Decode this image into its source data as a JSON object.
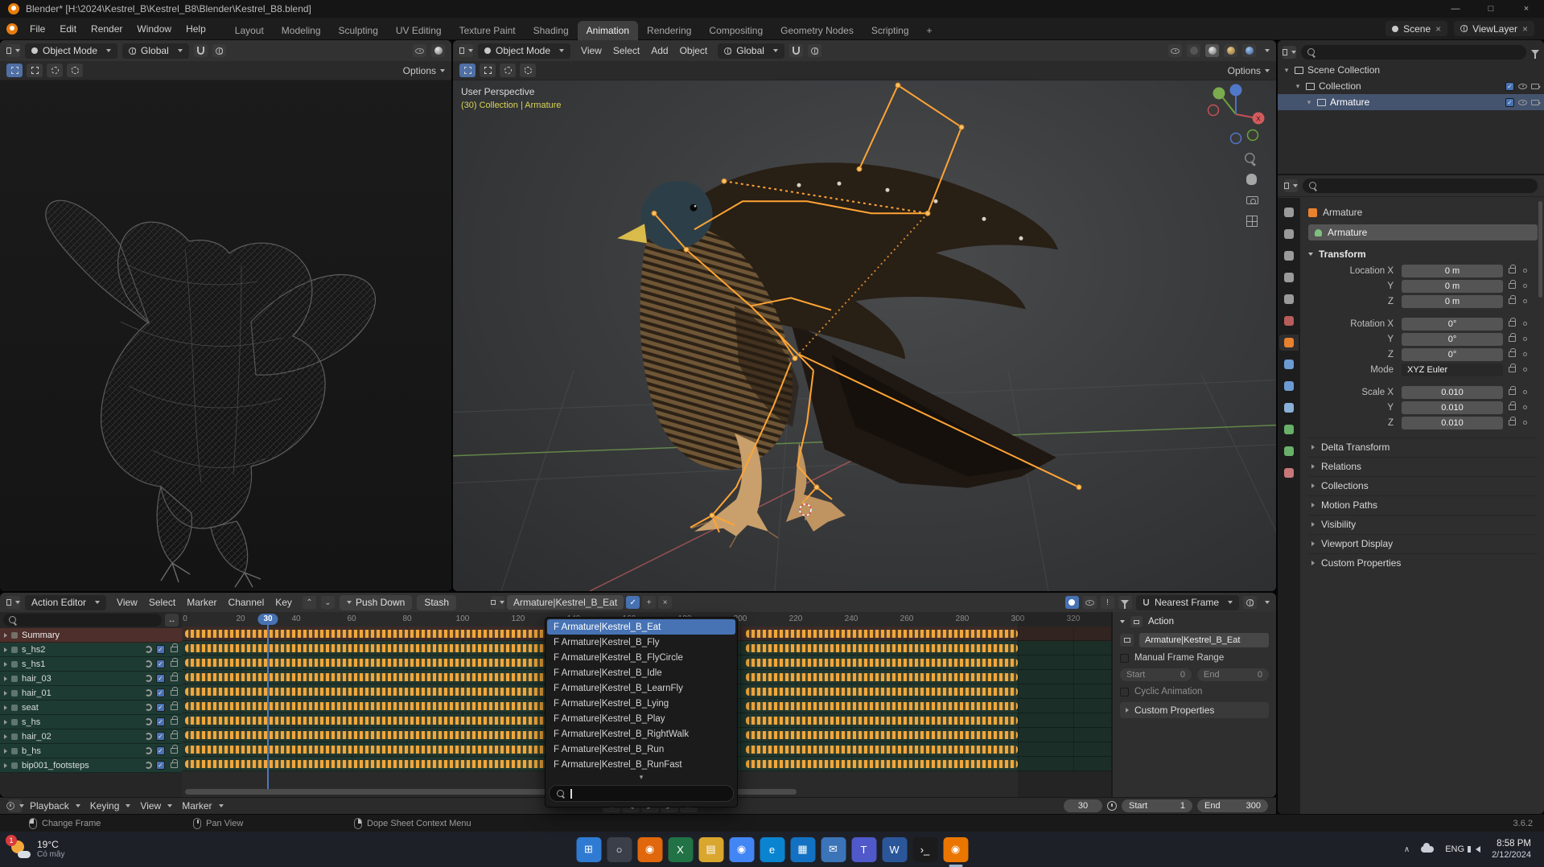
{
  "titlebar": {
    "title": "Blender* [H:\\2024\\Kestrel_B\\Kestrel_B8\\Blender\\Kestrel_B8.blend]",
    "minimize": "—",
    "maximize": "□",
    "close": "×"
  },
  "topbar": {
    "menus": [
      {
        "label": "File",
        "name": "menu-file"
      },
      {
        "label": "Edit",
        "name": "menu-edit"
      },
      {
        "label": "Render",
        "name": "menu-render"
      },
      {
        "label": "Window",
        "name": "menu-window"
      },
      {
        "label": "Help",
        "name": "menu-help"
      }
    ],
    "tabs": [
      {
        "label": "Layout",
        "name": "tab-layout"
      },
      {
        "label": "Modeling",
        "name": "tab-modeling"
      },
      {
        "label": "Sculpting",
        "name": "tab-sculpting"
      },
      {
        "label": "UV Editing",
        "name": "tab-uv-editing"
      },
      {
        "label": "Texture Paint",
        "name": "tab-texture-paint"
      },
      {
        "label": "Shading",
        "name": "tab-shading"
      },
      {
        "label": "Animation",
        "name": "tab-animation",
        "cls": "active"
      },
      {
        "label": "Rendering",
        "name": "tab-rendering"
      },
      {
        "label": "Compositing",
        "name": "tab-compositing"
      },
      {
        "label": "Geometry Nodes",
        "name": "tab-geometry-nodes"
      },
      {
        "label": "Scripting",
        "name": "tab-scripting"
      },
      {
        "label": "+",
        "name": "tab-add"
      }
    ],
    "scene": "Scene",
    "viewlayer": "ViewLayer"
  },
  "viewport_left": {
    "mode": "Object Mode",
    "orientation": "Global",
    "options": "Options"
  },
  "viewport_right": {
    "mode": "Object Mode",
    "menus": [
      {
        "label": "View",
        "name": "menu-view"
      },
      {
        "label": "Select",
        "name": "menu-select"
      },
      {
        "label": "Add",
        "name": "menu-add"
      },
      {
        "label": "Object",
        "name": "menu-object"
      }
    ],
    "orientation": "Global",
    "options": "Options",
    "overlay_line1": "User Perspective",
    "overlay_line2": "(30) Collection | Armature",
    "gizmo_x": "X"
  },
  "outliner": {
    "rows": [
      {
        "label": "Scene Collection",
        "depth": 0,
        "cls": "scene"
      },
      {
        "label": "Collection",
        "depth": 1,
        "cls": "collection"
      },
      {
        "label": "Armature",
        "depth": 2,
        "cls": "armature selected"
      }
    ]
  },
  "properties": {
    "breadcrumb": "Armature",
    "name": "Armature",
    "transform_title": "Transform",
    "rows": [
      {
        "label": "Location X",
        "value": "0 m"
      },
      {
        "label": "Y",
        "value": "0 m"
      },
      {
        "label": "Z",
        "value": "0 m"
      },
      {
        "label": "Rotation X",
        "value": "0°",
        "cls": "gap"
      },
      {
        "label": "Y",
        "value": "0°"
      },
      {
        "label": "Z",
        "value": "0°"
      },
      {
        "label": "Mode",
        "value": "XYZ Euler",
        "cls": "select"
      },
      {
        "label": "Scale X",
        "value": "0.010",
        "cls": "gap"
      },
      {
        "label": "Y",
        "value": "0.010"
      },
      {
        "label": "Z",
        "value": "0.010"
      }
    ],
    "sections": [
      "Delta Transform",
      "Relations",
      "Collections",
      "Motion Paths",
      "Visibility",
      "Viewport Display",
      "Custom Properties"
    ]
  },
  "properties_tabs": [
    {
      "name": "tab-tool",
      "color": "#9a9a9a"
    },
    {
      "name": "tab-render",
      "color": "#9a9a9a"
    },
    {
      "name": "tab-output",
      "color": "#9a9a9a"
    },
    {
      "name": "tab-view-layer",
      "color": "#9a9a9a"
    },
    {
      "name": "tab-scene",
      "color": "#9a9a9a"
    },
    {
      "name": "tab-world",
      "color": "#b85c5c"
    },
    {
      "name": "tab-object",
      "color": "#e8822e",
      "cls": "active"
    },
    {
      "name": "tab-modifiers",
      "color": "#6b9bd2"
    },
    {
      "name": "tab-physics",
      "color": "#6b9bd2"
    },
    {
      "name": "tab-constraints",
      "color": "#8ab0d8"
    },
    {
      "name": "tab-data",
      "color": "#69b06a"
    },
    {
      "name": "tab-bone",
      "color": "#69b06a"
    },
    {
      "name": "tab-material",
      "color": "#c77777"
    }
  ],
  "dopesheet": {
    "editor": "Action Editor",
    "menus": [
      {
        "label": "View",
        "name": "menu-view"
      },
      {
        "label": "Select",
        "name": "menu-select"
      },
      {
        "label": "Marker",
        "name": "menu-marker"
      },
      {
        "label": "Channel",
        "name": "menu-channel"
      },
      {
        "label": "Key",
        "name": "menu-key"
      }
    ],
    "push_down": "Push Down",
    "stash": "Stash",
    "action_name": "Armature|Kestrel_B_Eat",
    "snap": "Nearest Frame",
    "channels": [
      {
        "label": "Summary",
        "cls": "summary"
      },
      {
        "label": "s_hs2"
      },
      {
        "label": "s_hs1"
      },
      {
        "label": "hair_03"
      },
      {
        "label": "hair_01"
      },
      {
        "label": "seat"
      },
      {
        "label": "s_hs"
      },
      {
        "label": "hair_02"
      },
      {
        "label": "b_hs"
      },
      {
        "label": "bip001_footsteps"
      }
    ],
    "ticks": [
      "0",
      "20",
      "40",
      "60",
      "80",
      "100",
      "120",
      "140",
      "160",
      "180",
      "200",
      "220",
      "240",
      "260",
      "280",
      "300",
      "320"
    ],
    "current_frame": "30",
    "keyframe_ranges": [
      [
        0,
        131
      ],
      [
        202,
        300
      ]
    ]
  },
  "action_menu": {
    "items": [
      "F Armature|Kestrel_B_Eat",
      "F Armature|Kestrel_B_Fly",
      "F Armature|Kestrel_B_FlyCircle",
      "F Armature|Kestrel_B_Idle",
      "F Armature|Kestrel_B_LearnFly",
      "F Armature|Kestrel_B_Lying",
      "F Armature|Kestrel_B_Play",
      "F Armature|Kestrel_B_RightWalk",
      "F Armature|Kestrel_B_Run",
      "F Armature|Kestrel_B_RunFast"
    ]
  },
  "action_panel": {
    "title": "Action",
    "datablock": "Armature|Kestrel_B_Eat",
    "manual_range": "Manual Frame Range",
    "start_label": "Start",
    "start_value": "0",
    "end_label": "End",
    "end_value": "0",
    "cyclic": "Cyclic Animation",
    "custom_properties": "Custom Properties"
  },
  "playbar": {
    "menus": [
      {
        "label": "Playback",
        "name": "menu-playback"
      },
      {
        "label": "Keying",
        "name": "menu-keying"
      },
      {
        "label": "View",
        "name": "menu-view"
      },
      {
        "label": "Marker",
        "name": "menu-marker"
      }
    ],
    "transport": [
      {
        "glyph": "«",
        "name": "jump-to-start-button"
      },
      {
        "glyph": "◀",
        "name": "play-reverse-button"
      },
      {
        "glyph": "▶",
        "name": "play-button"
      },
      {
        "glyph": "▶",
        "name": "next-keyframe-button"
      },
      {
        "glyph": "»",
        "name": "jump-to-end-button"
      }
    ],
    "frame": "30",
    "start_label": "Start",
    "start_value": "1",
    "end_label": "End",
    "end_value": "300"
  },
  "statusbar": {
    "left": "Change Frame",
    "middle": "Pan View",
    "right": "Dope Sheet Context Menu",
    "version": "3.6.2"
  },
  "taskbar": {
    "badge": "1",
    "weather_temp": "19°C",
    "weather_desc": "Có mây",
    "apps": [
      {
        "name": "start-button",
        "glyph": "⊞",
        "color": "#2f7bd4"
      },
      {
        "name": "search-icon",
        "glyph": "○",
        "color": "#3a3f4a"
      },
      {
        "name": "firefox-icon",
        "glyph": "◉",
        "color": "#e0670b"
      },
      {
        "name": "excel-icon",
        "glyph": "X",
        "color": "#217346"
      },
      {
        "name": "explorer-icon",
        "glyph": "▤",
        "color": "#d9a62e"
      },
      {
        "name": "chrome-icon",
        "glyph": "◉",
        "color": "#4285f4"
      },
      {
        "name": "edge-icon",
        "glyph": "e",
        "color": "#0a84d0"
      },
      {
        "name": "store-icon",
        "glyph": "▦",
        "color": "#1271c2"
      },
      {
        "name": "mail-icon",
        "glyph": "✉",
        "color": "#3b74b8"
      },
      {
        "name": "teams-icon",
        "glyph": "T",
        "color": "#5059c9"
      },
      {
        "name": "word-icon",
        "glyph": "W",
        "color": "#2b579a"
      },
      {
        "name": "terminal-icon",
        "glyph": "›_",
        "color": "#1b1b1b"
      },
      {
        "name": "blender-icon",
        "glyph": "◉",
        "color": "#ea7600",
        "cls": "active"
      }
    ],
    "lang": "ENG",
    "time": "8:58 PM",
    "date": "2/12/2024"
  }
}
